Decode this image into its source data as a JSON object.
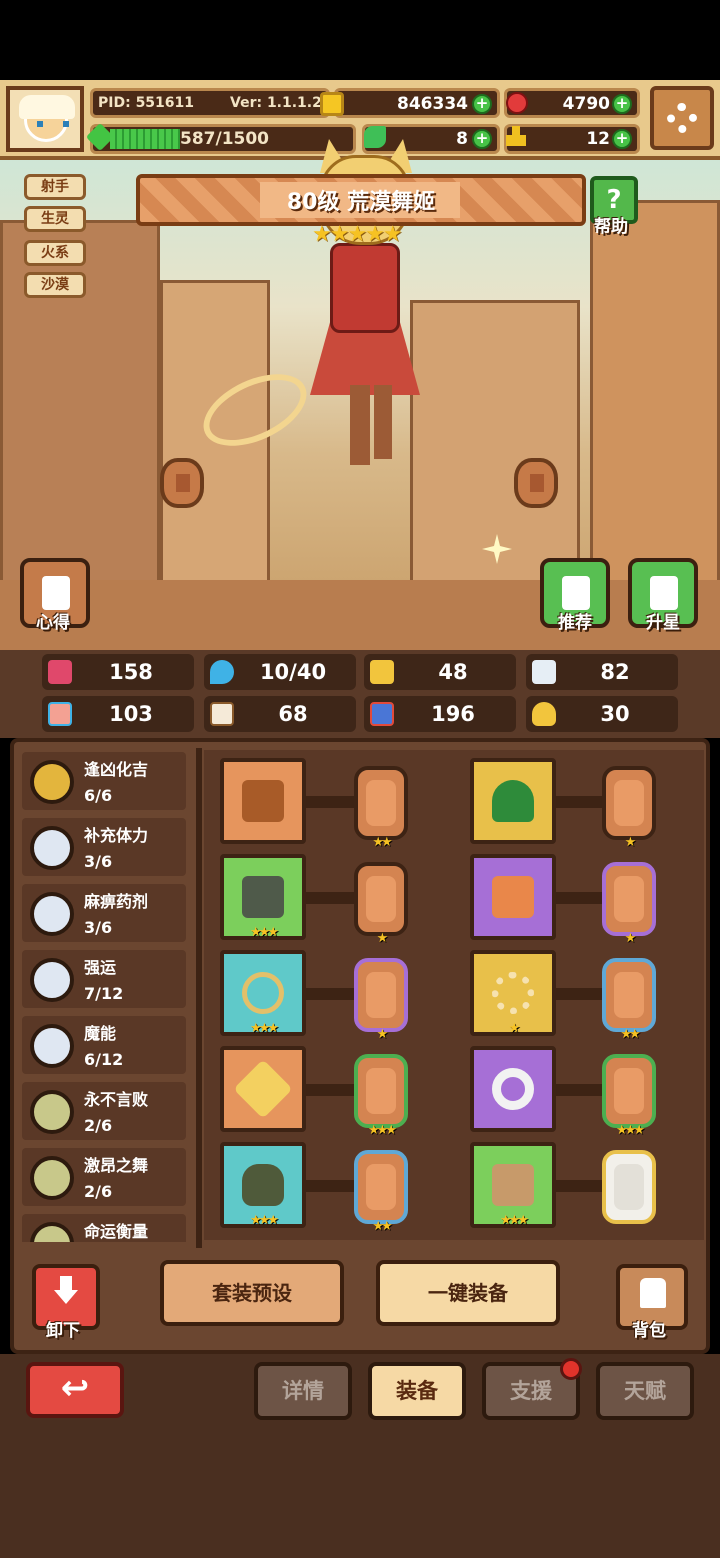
{
  "hud": {
    "pid": "PID: 551611",
    "version": "Ver: 1.1.1.2",
    "xp": "587/1500",
    "gold": "846334",
    "gems": "4790",
    "clover": "8",
    "keys": "12",
    "plus": "+"
  },
  "tags": [
    "射手",
    "生灵",
    "火系",
    "沙漠"
  ],
  "hero": {
    "title": "80级  荒漠舞姬",
    "stars": "★★★★★"
  },
  "buttons": {
    "help": "帮助",
    "help_glyph": "?",
    "xinde": "心得",
    "tuijian": "推荐",
    "shengxing": "升星",
    "taozhuang": "套装预设",
    "yijian": "一键装备",
    "xiexia": "卸下",
    "beibao": "背包",
    "back_glyph": "↩"
  },
  "stats": [
    "158",
    "10/40",
    "48",
    "82",
    "103",
    "68",
    "196",
    "30"
  ],
  "sets": [
    {
      "name": "逢凶化吉",
      "count": "6/6",
      "color": "#e3b53d"
    },
    {
      "name": "补充体力",
      "count": "3/6",
      "color": "#dfe7f2"
    },
    {
      "name": "麻痹药剂",
      "count": "3/6",
      "color": "#dfe7f2"
    },
    {
      "name": "强运",
      "count": "7/12",
      "color": "#dfe7f2"
    },
    {
      "name": "魔能",
      "count": "6/12",
      "color": "#dfe7f2"
    },
    {
      "name": "永不言败",
      "count": "2/6",
      "color": "#c8c88a"
    },
    {
      "name": "激昂之舞",
      "count": "2/6",
      "color": "#c8c88a"
    },
    {
      "name": "命运衡量",
      "count": "",
      "color": "#c8c88a"
    }
  ],
  "equipment": [
    {
      "item_bg": "#e6955d",
      "item_stars": "",
      "rune_border": "#d48451",
      "rune_stars": "★★"
    },
    {
      "item_bg": "#e8c04a",
      "item_stars": "",
      "rune_border": "#d48451",
      "rune_stars": "★"
    },
    {
      "item_bg": "#7ccf5c",
      "item_stars": "★★★",
      "rune_border": "#d48451",
      "rune_stars": "★"
    },
    {
      "item_bg": "#a66fd6",
      "item_stars": "",
      "rune_border": "#a66fd6",
      "rune_stars": "★"
    },
    {
      "item_bg": "#5fc9c9",
      "item_stars": "★★★",
      "rune_border": "#a66fd6",
      "rune_stars": "★"
    },
    {
      "item_bg": "#e8c04a",
      "item_stars": "★",
      "rune_border": "#5fa8d6",
      "rune_stars": "★★"
    },
    {
      "item_bg": "#e6955d",
      "item_stars": "",
      "rune_border": "#4caf50",
      "rune_stars": "★★★"
    },
    {
      "item_bg": "#a66fd6",
      "item_stars": "",
      "rune_border": "#4caf50",
      "rune_stars": "★★★"
    },
    {
      "item_bg": "#5fc9c9",
      "item_stars": "★★★",
      "rune_border": "#5fa8d6",
      "rune_stars": "★★"
    },
    {
      "item_bg": "#7ccf5c",
      "item_stars": "★★★",
      "rune_border": "#e8c04a",
      "rune_stars": ""
    }
  ],
  "tabs": {
    "xiangqing": "详情",
    "zhuangbei": "装备",
    "zhiyuan": "支援",
    "tianfu": "天赋"
  }
}
